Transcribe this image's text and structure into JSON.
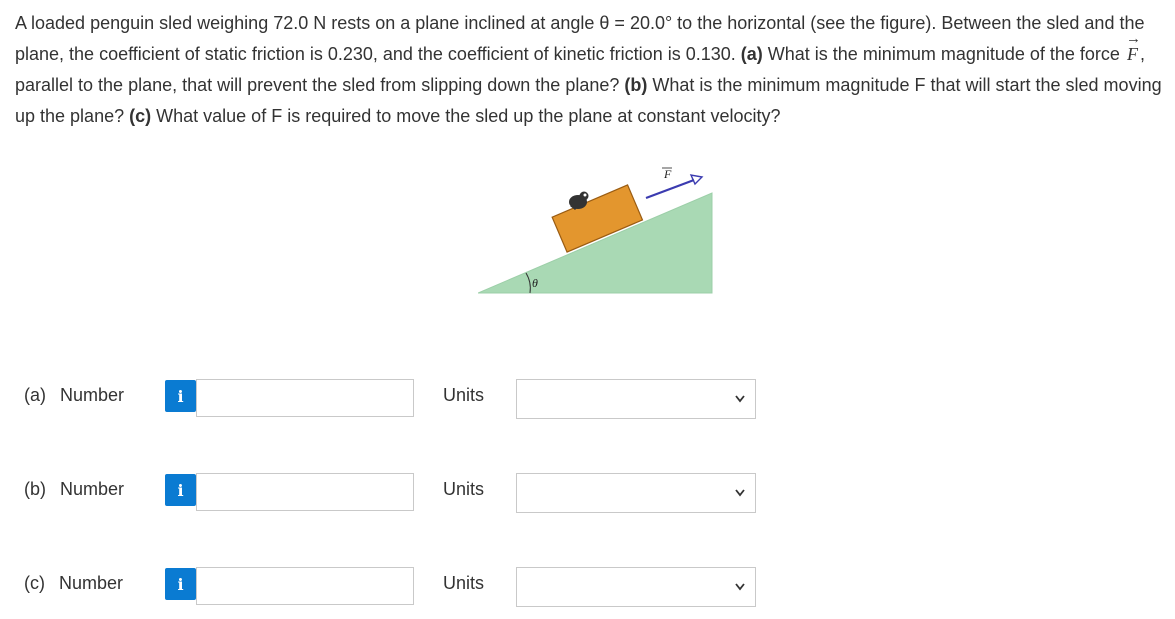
{
  "question": {
    "part1": "A loaded penguin sled weighing 72.0 N rests on a plane inclined at angle θ = 20.0° to the horizontal (see the figure). Between the sled and the plane, the coefficient of static friction is 0.230, and the coefficient of kinetic friction is 0.130.",
    "a_tag": "(a)",
    "a_text1": "What is the minimum magnitude of the force",
    "force_symbol": "F",
    "a_text2": ", parallel to the plane, that will prevent the sled from slipping down the plane?",
    "b_tag": "(b)",
    "b_text": "What is the minimum magnitude F that will start the sled moving up the plane?",
    "c_tag": "(c)",
    "c_text": "What value of F is required to move the sled up the plane at constant velocity?"
  },
  "figure": {
    "force_label": "F",
    "angle_label": "θ",
    "colors": {
      "slope": "#a9d9b4",
      "sled": "#e3962e",
      "arrow": "#3b3bb0"
    }
  },
  "answers": [
    {
      "part": "(a)",
      "label": "Number",
      "info_icon": "i",
      "units_label": "Units",
      "value": "",
      "unit": ""
    },
    {
      "part": "(b)",
      "label": "Number",
      "info_icon": "i",
      "units_label": "Units",
      "value": "",
      "unit": ""
    },
    {
      "part": "(c)",
      "label": "Number",
      "info_icon": "i",
      "units_label": "Units",
      "value": "",
      "unit": ""
    }
  ],
  "colors": {
    "info_button": "#0a7bd2",
    "border": "#c9c9c9",
    "text": "#333333"
  }
}
